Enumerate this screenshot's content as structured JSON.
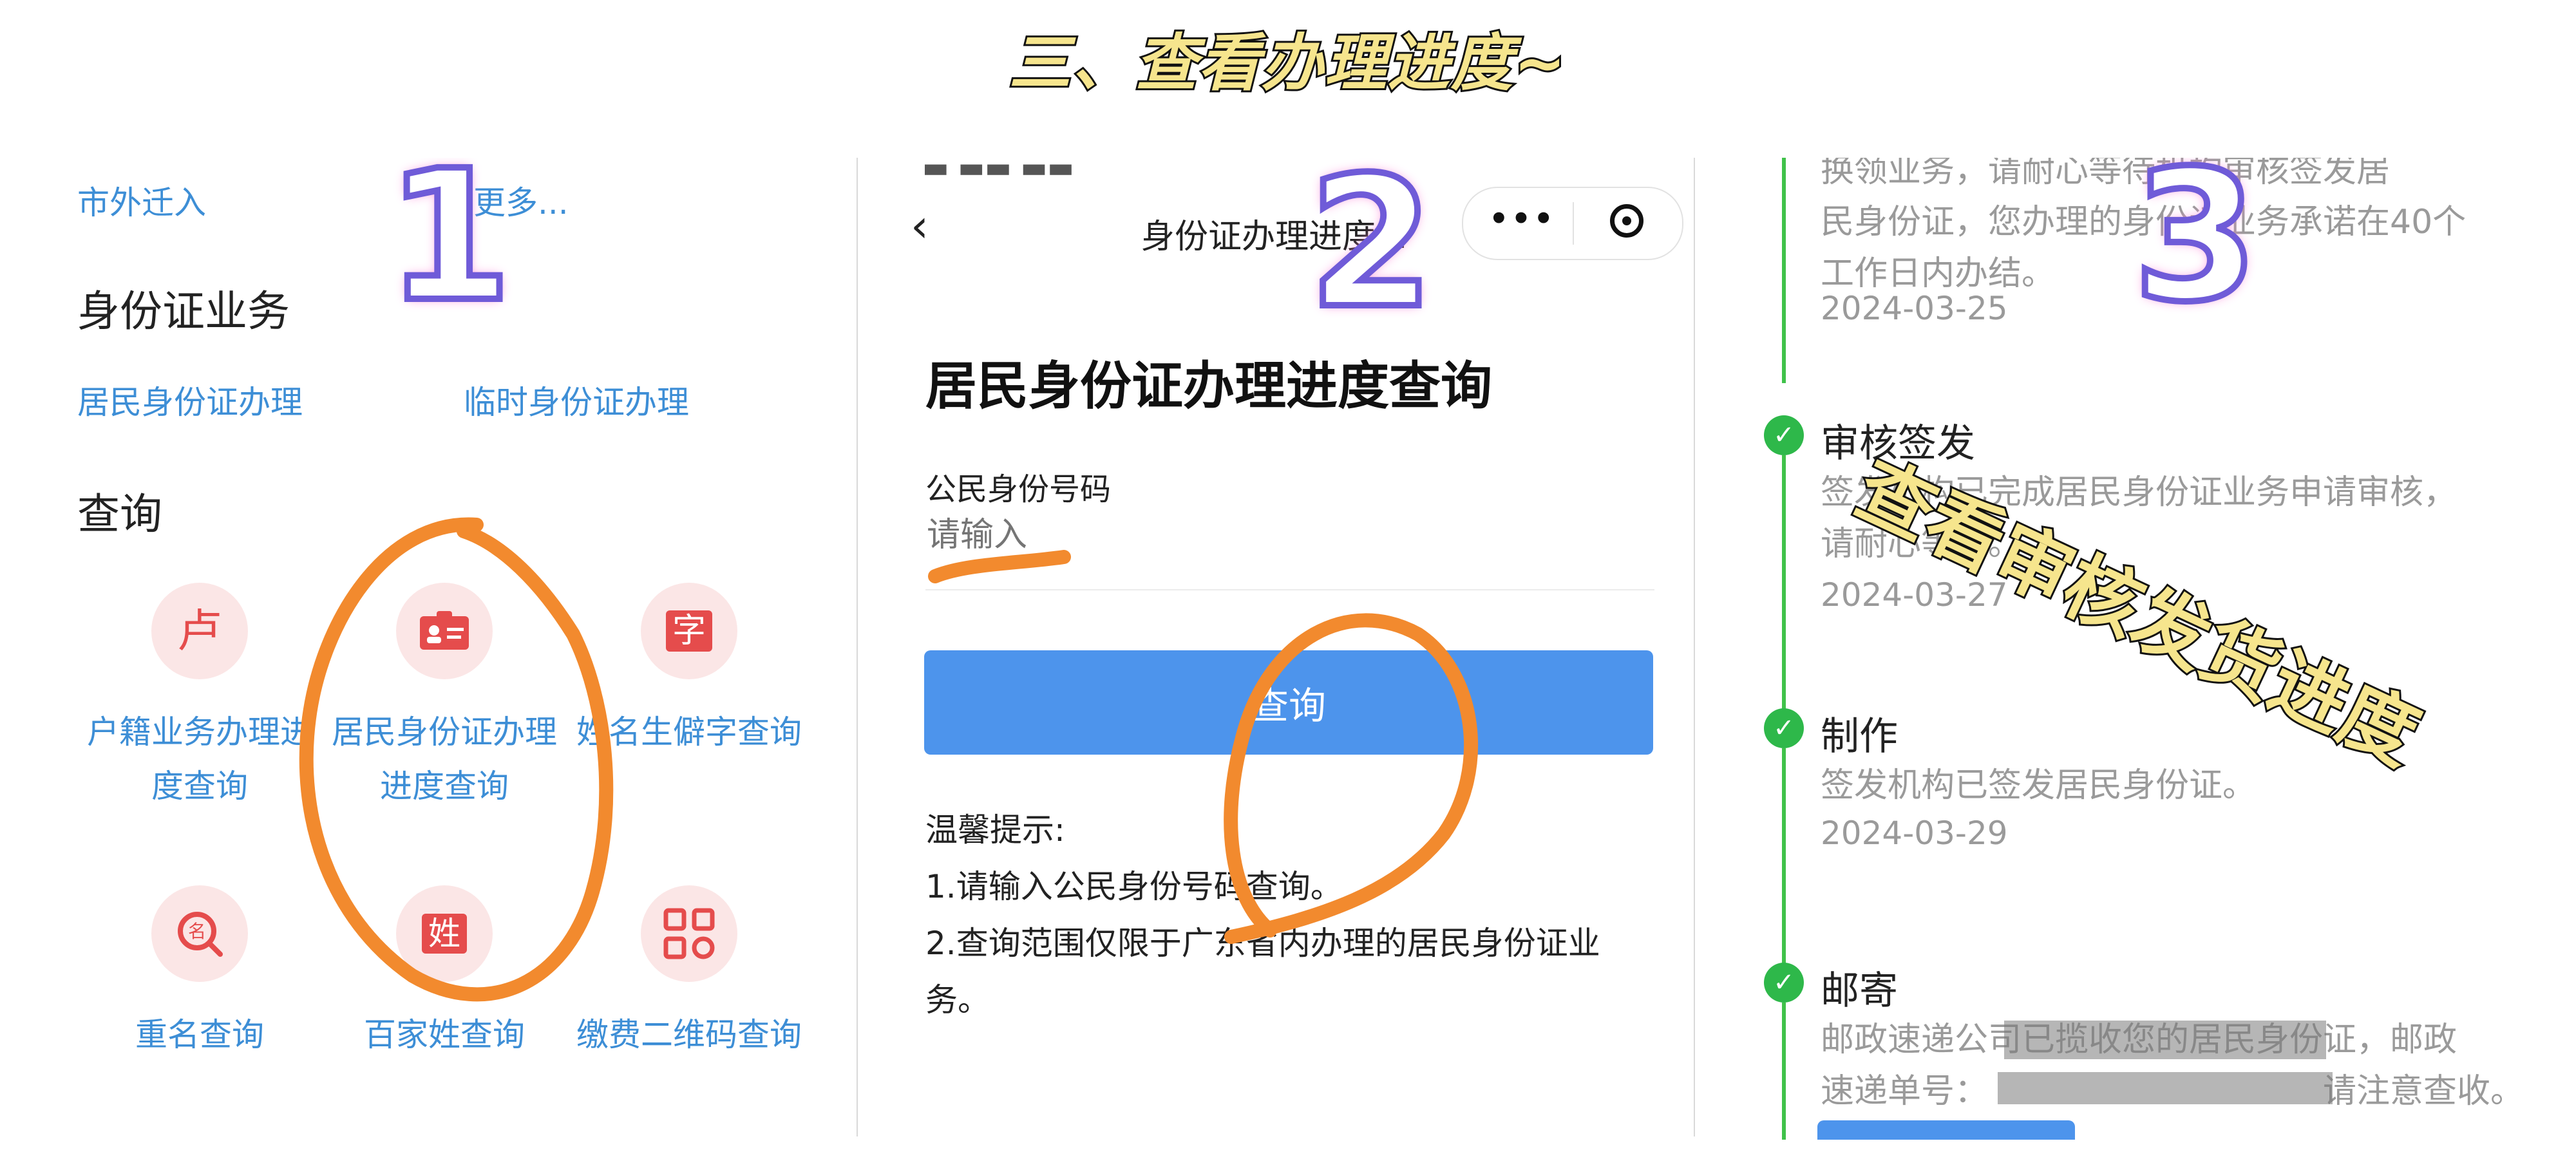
{
  "title": "三、查看办理进度~",
  "panel1": {
    "top_links": [
      "市外迁入",
      "更多..."
    ],
    "section_id": "身份证业务",
    "id_links": [
      "居民身份证办理",
      "临时身份证办理"
    ],
    "section_query": "查询",
    "items": [
      {
        "label_line1": "户籍业务办理进",
        "label_line2": "度查询",
        "icon": "household-progress-icon",
        "glyph": "卢"
      },
      {
        "label_line1": "居民身份证办理",
        "label_line2": "进度查询",
        "icon": "id-card-icon",
        "glyph": "▣"
      },
      {
        "label_line1": "姓名生僻字查询",
        "label_line2": "",
        "icon": "rare-character-icon",
        "glyph": "字"
      },
      {
        "label_line1": "重名查询",
        "label_line2": "",
        "icon": "duplicate-name-icon",
        "glyph": "名"
      },
      {
        "label_line1": "百家姓查询",
        "label_line2": "",
        "icon": "surname-icon",
        "glyph": "姓"
      },
      {
        "label_line1": "缴费二维码查询",
        "label_line2": "",
        "icon": "qr-code-icon",
        "glyph": "▦"
      }
    ],
    "step_number": "1"
  },
  "panel2": {
    "status_bar": "▬ ▬▬ ▬▬",
    "nav_title": "身份证办理进度...",
    "heading": "居民身份证办理进度查询",
    "field_label": "公民身份号码",
    "placeholder": "请输入",
    "query_button": "查询",
    "tips_title": "温馨提示:",
    "tips": [
      "1.请输入公民身份号码查询。",
      "2.查询范围仅限于广东省内办理的居民身份证业",
      "务。"
    ],
    "step_number": "2"
  },
  "panel3": {
    "top_text": [
      "换领业务，请耐心等待机构审核签发居",
      "民身份证，您办理的身份证业务承诺在40个",
      "工作日内办结。"
    ],
    "top_date": "2024-03-25",
    "steps": [
      {
        "title": "审核签发",
        "text": [
          "签发机构已完成居民身份证业务申请审核，",
          "请耐心等待。"
        ],
        "date": "2024-03-27"
      },
      {
        "title": "制作",
        "text": [
          "签发机构已签发居民身份证。"
        ],
        "date": "2024-03-29"
      },
      {
        "title": "邮寄",
        "text": [
          "邮政速递公司已揽收您的居民身份证，邮政",
          "速递单号：",
          "请注意查收。"
        ],
        "date": ""
      }
    ],
    "overlay": "查看审核发货进度",
    "step_number": "3"
  },
  "colors": {
    "link": "#3d8ed6",
    "button": "#4d94ec",
    "timeline": "#2eb84a",
    "annotation": "#f28a2e",
    "title_fill": "#f6e58d"
  }
}
